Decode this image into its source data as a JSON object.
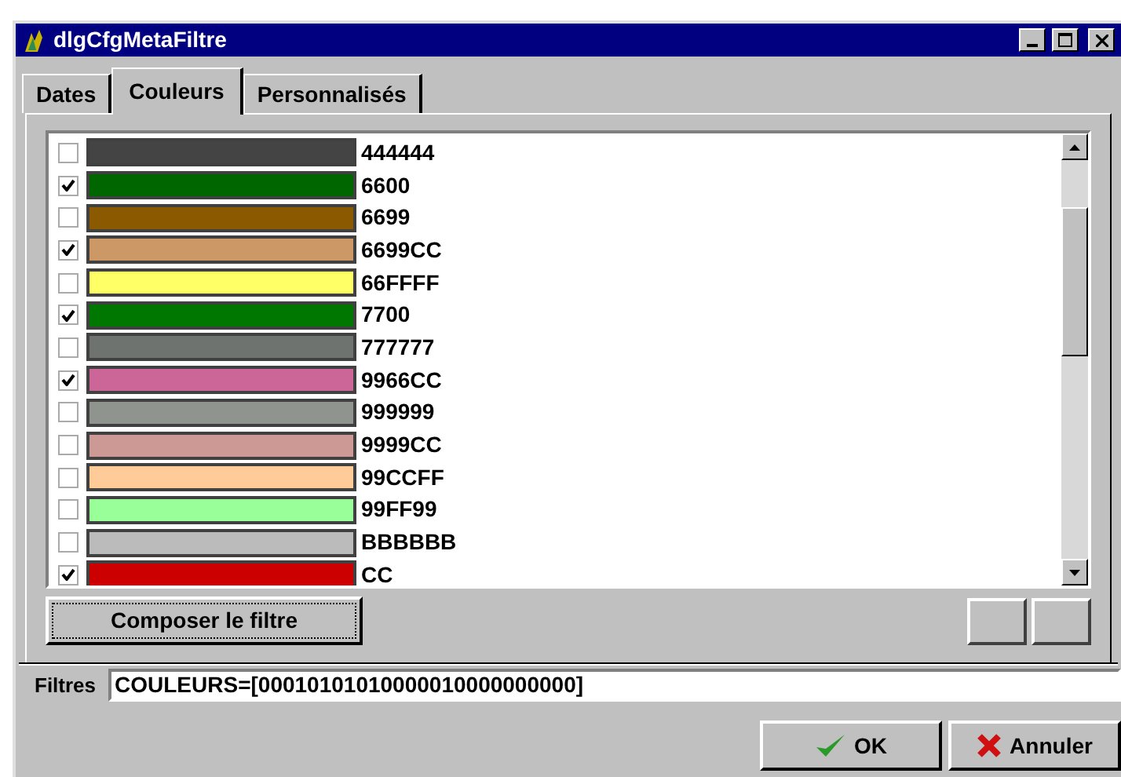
{
  "window": {
    "title": "dlgCfgMetaFiltre"
  },
  "tabs": [
    {
      "label": "Dates",
      "selected": false
    },
    {
      "label": "Couleurs",
      "selected": true
    },
    {
      "label": "Personnalisés",
      "selected": false
    }
  ],
  "colors": [
    {
      "label": "444444",
      "checked": false,
      "color": "#444444"
    },
    {
      "label": "6600",
      "checked": true,
      "color": "#006600"
    },
    {
      "label": "6699",
      "checked": false,
      "color": "#8b5a00"
    },
    {
      "label": "6699CC",
      "checked": true,
      "color": "#cc9966"
    },
    {
      "label": "66FFFF",
      "checked": false,
      "color": "#ffff66"
    },
    {
      "label": "7700",
      "checked": true,
      "color": "#007700"
    },
    {
      "label": "777777",
      "checked": false,
      "color": "#6f736f"
    },
    {
      "label": "9966CC",
      "checked": true,
      "color": "#cc6699"
    },
    {
      "label": "999999",
      "checked": false,
      "color": "#8f948f"
    },
    {
      "label": "9999CC",
      "checked": false,
      "color": "#cc9994"
    },
    {
      "label": "99CCFF",
      "checked": false,
      "color": "#ffcc99"
    },
    {
      "label": "99FF99",
      "checked": false,
      "color": "#99ff99"
    },
    {
      "label": "BBBBBB",
      "checked": false,
      "color": "#bbbbbb"
    },
    {
      "label": "CC",
      "checked": true,
      "color": "#cc0000"
    }
  ],
  "compose_button": "Composer le filtre",
  "filter": {
    "label": "Filtres",
    "value": "COULEURS=[00010101010000010000000000]"
  },
  "buttons": [
    {
      "kind": "ok",
      "label": "OK"
    },
    {
      "kind": "cancel",
      "label": "Annuler"
    }
  ]
}
